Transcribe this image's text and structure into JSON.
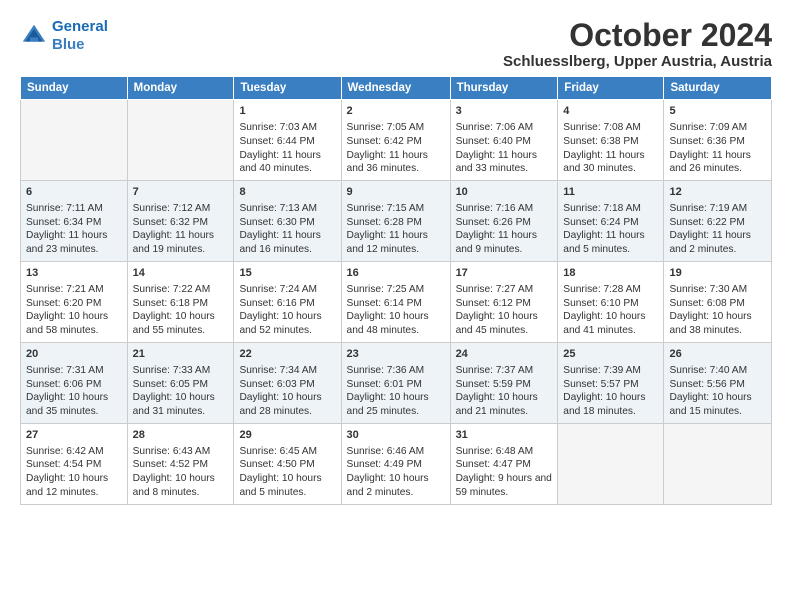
{
  "logo": {
    "line1": "General",
    "line2": "Blue"
  },
  "title": "October 2024",
  "location": "Schluesslberg, Upper Austria, Austria",
  "weekdays": [
    "Sunday",
    "Monday",
    "Tuesday",
    "Wednesday",
    "Thursday",
    "Friday",
    "Saturday"
  ],
  "weeks": [
    [
      {
        "day": "",
        "info": ""
      },
      {
        "day": "",
        "info": ""
      },
      {
        "day": "1",
        "info": "Sunrise: 7:03 AM\nSunset: 6:44 PM\nDaylight: 11 hours and 40 minutes."
      },
      {
        "day": "2",
        "info": "Sunrise: 7:05 AM\nSunset: 6:42 PM\nDaylight: 11 hours and 36 minutes."
      },
      {
        "day": "3",
        "info": "Sunrise: 7:06 AM\nSunset: 6:40 PM\nDaylight: 11 hours and 33 minutes."
      },
      {
        "day": "4",
        "info": "Sunrise: 7:08 AM\nSunset: 6:38 PM\nDaylight: 11 hours and 30 minutes."
      },
      {
        "day": "5",
        "info": "Sunrise: 7:09 AM\nSunset: 6:36 PM\nDaylight: 11 hours and 26 minutes."
      }
    ],
    [
      {
        "day": "6",
        "info": "Sunrise: 7:11 AM\nSunset: 6:34 PM\nDaylight: 11 hours and 23 minutes."
      },
      {
        "day": "7",
        "info": "Sunrise: 7:12 AM\nSunset: 6:32 PM\nDaylight: 11 hours and 19 minutes."
      },
      {
        "day": "8",
        "info": "Sunrise: 7:13 AM\nSunset: 6:30 PM\nDaylight: 11 hours and 16 minutes."
      },
      {
        "day": "9",
        "info": "Sunrise: 7:15 AM\nSunset: 6:28 PM\nDaylight: 11 hours and 12 minutes."
      },
      {
        "day": "10",
        "info": "Sunrise: 7:16 AM\nSunset: 6:26 PM\nDaylight: 11 hours and 9 minutes."
      },
      {
        "day": "11",
        "info": "Sunrise: 7:18 AM\nSunset: 6:24 PM\nDaylight: 11 hours and 5 minutes."
      },
      {
        "day": "12",
        "info": "Sunrise: 7:19 AM\nSunset: 6:22 PM\nDaylight: 11 hours and 2 minutes."
      }
    ],
    [
      {
        "day": "13",
        "info": "Sunrise: 7:21 AM\nSunset: 6:20 PM\nDaylight: 10 hours and 58 minutes."
      },
      {
        "day": "14",
        "info": "Sunrise: 7:22 AM\nSunset: 6:18 PM\nDaylight: 10 hours and 55 minutes."
      },
      {
        "day": "15",
        "info": "Sunrise: 7:24 AM\nSunset: 6:16 PM\nDaylight: 10 hours and 52 minutes."
      },
      {
        "day": "16",
        "info": "Sunrise: 7:25 AM\nSunset: 6:14 PM\nDaylight: 10 hours and 48 minutes."
      },
      {
        "day": "17",
        "info": "Sunrise: 7:27 AM\nSunset: 6:12 PM\nDaylight: 10 hours and 45 minutes."
      },
      {
        "day": "18",
        "info": "Sunrise: 7:28 AM\nSunset: 6:10 PM\nDaylight: 10 hours and 41 minutes."
      },
      {
        "day": "19",
        "info": "Sunrise: 7:30 AM\nSunset: 6:08 PM\nDaylight: 10 hours and 38 minutes."
      }
    ],
    [
      {
        "day": "20",
        "info": "Sunrise: 7:31 AM\nSunset: 6:06 PM\nDaylight: 10 hours and 35 minutes."
      },
      {
        "day": "21",
        "info": "Sunrise: 7:33 AM\nSunset: 6:05 PM\nDaylight: 10 hours and 31 minutes."
      },
      {
        "day": "22",
        "info": "Sunrise: 7:34 AM\nSunset: 6:03 PM\nDaylight: 10 hours and 28 minutes."
      },
      {
        "day": "23",
        "info": "Sunrise: 7:36 AM\nSunset: 6:01 PM\nDaylight: 10 hours and 25 minutes."
      },
      {
        "day": "24",
        "info": "Sunrise: 7:37 AM\nSunset: 5:59 PM\nDaylight: 10 hours and 21 minutes."
      },
      {
        "day": "25",
        "info": "Sunrise: 7:39 AM\nSunset: 5:57 PM\nDaylight: 10 hours and 18 minutes."
      },
      {
        "day": "26",
        "info": "Sunrise: 7:40 AM\nSunset: 5:56 PM\nDaylight: 10 hours and 15 minutes."
      }
    ],
    [
      {
        "day": "27",
        "info": "Sunrise: 6:42 AM\nSunset: 4:54 PM\nDaylight: 10 hours and 12 minutes."
      },
      {
        "day": "28",
        "info": "Sunrise: 6:43 AM\nSunset: 4:52 PM\nDaylight: 10 hours and 8 minutes."
      },
      {
        "day": "29",
        "info": "Sunrise: 6:45 AM\nSunset: 4:50 PM\nDaylight: 10 hours and 5 minutes."
      },
      {
        "day": "30",
        "info": "Sunrise: 6:46 AM\nSunset: 4:49 PM\nDaylight: 10 hours and 2 minutes."
      },
      {
        "day": "31",
        "info": "Sunrise: 6:48 AM\nSunset: 4:47 PM\nDaylight: 9 hours and 59 minutes."
      },
      {
        "day": "",
        "info": ""
      },
      {
        "day": "",
        "info": ""
      }
    ]
  ]
}
